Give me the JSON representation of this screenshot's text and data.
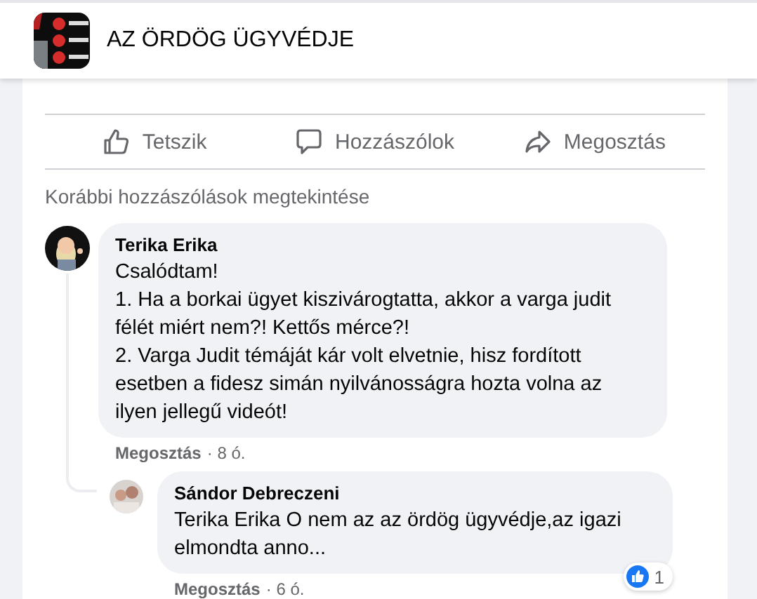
{
  "page": {
    "title": "AZ ÖRDÖG ÜGYVÉDJE"
  },
  "actions": [
    {
      "label": "Tetszik",
      "kind": "like"
    },
    {
      "label": "Hozzászólok",
      "kind": "comment"
    },
    {
      "label": "Megosztás",
      "kind": "share"
    }
  ],
  "view_more": "Korábbi hozzászólások megtekintése",
  "comments": [
    {
      "author": "Terika Erika",
      "paragraphs": [
        "Csalódtam!",
        "1. Ha a borkai ügyet kiszivárogtatta, akkor a varga judit félét miért nem?! Kettős mérce?!",
        "2. Varga Judit témáját kár volt elvetnie, hisz fordított esetben a fidesz simán nyilvánosságra hozta volna az ilyen jellegű videót!"
      ],
      "share_link": "Megosztás",
      "time": "· 8 ó.",
      "replies": [
        {
          "author": "Sándor Debreczeni",
          "paragraphs": [
            "Terika Erika O nem az az ördög ügyvédje,az igazi elmondta anno..."
          ],
          "share_link": "Megosztás",
          "time": "· 6 ó.",
          "like_count": "1"
        }
      ]
    }
  ]
}
